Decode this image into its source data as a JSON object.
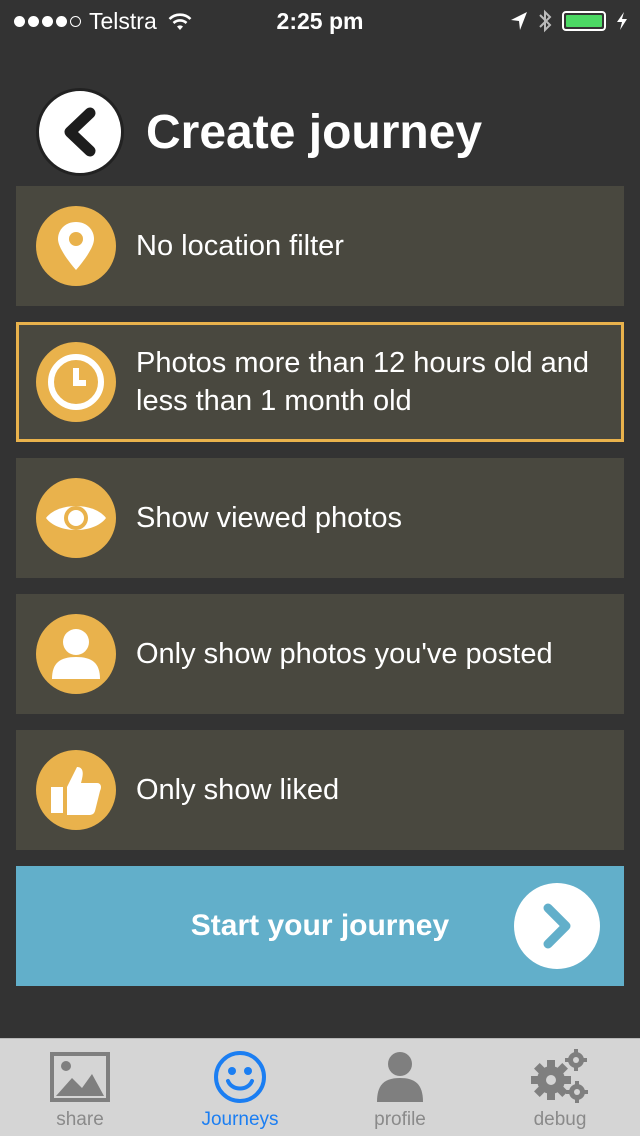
{
  "status_bar": {
    "carrier": "Telstra",
    "time": "2:25 pm",
    "signal_bars_filled": 4,
    "signal_bars_total": 5,
    "battery_color": "#4cd964"
  },
  "header": {
    "title": "Create journey",
    "back_icon": "chevron-left-icon"
  },
  "options": [
    {
      "icon": "location-pin-icon",
      "label": "No location filter",
      "selected": false
    },
    {
      "icon": "clock-icon",
      "label": "Photos more than 12 hours old and less than 1 month old",
      "selected": true
    },
    {
      "icon": "eye-icon",
      "label": "Show viewed photos",
      "selected": false
    },
    {
      "icon": "user-icon",
      "label": "Only show photos you've posted",
      "selected": false
    },
    {
      "icon": "thumbs-up-icon",
      "label": "Only show liked",
      "selected": false
    }
  ],
  "start_button": {
    "label": "Start your journey",
    "icon": "chevron-right-icon"
  },
  "tab_bar": {
    "tabs": [
      {
        "label": "share",
        "icon": "image-icon",
        "active": false
      },
      {
        "label": "Journeys",
        "icon": "smiley-icon",
        "active": true
      },
      {
        "label": "profile",
        "icon": "person-icon",
        "active": false
      },
      {
        "label": "debug",
        "icon": "gears-icon",
        "active": false
      }
    ]
  },
  "colors": {
    "background": "#333333",
    "card": "#49483f",
    "accent": "#e9b24c",
    "start_button": "#62afca",
    "tab_active": "#1b7ef2",
    "tab_inactive": "#8a8a8a"
  }
}
